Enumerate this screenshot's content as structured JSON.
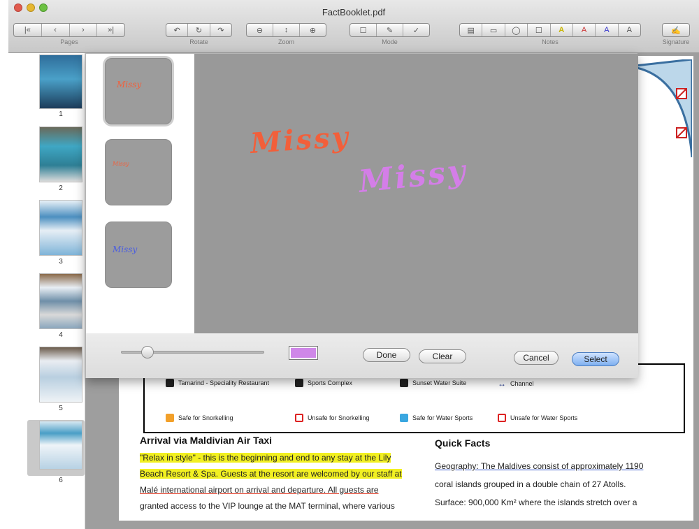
{
  "window": {
    "title": "FactBooklet.pdf"
  },
  "toolbar": {
    "groups": [
      {
        "label": "Pages",
        "buttons": [
          "|«",
          "‹",
          "›",
          "»|"
        ]
      },
      {
        "label": "Rotate",
        "buttons": [
          "↶",
          "↻",
          "↷"
        ]
      },
      {
        "label": "Zoom",
        "buttons": [
          "⊖",
          "↕",
          "⊕"
        ]
      },
      {
        "label": "Mode",
        "buttons": [
          "☐",
          "✎",
          "✓"
        ]
      },
      {
        "label": "Notes",
        "buttons": [
          "▤",
          "▭",
          "◯",
          "☐",
          "A",
          "A",
          "A",
          "A"
        ]
      },
      {
        "label": "Signature",
        "buttons": [
          "✍"
        ]
      }
    ]
  },
  "sidebar": {
    "pages": [
      {
        "num": "1"
      },
      {
        "num": "2"
      },
      {
        "num": "3"
      },
      {
        "num": "4"
      },
      {
        "num": "5"
      },
      {
        "num": "6"
      }
    ]
  },
  "signature_sheet": {
    "saved_signatures": [
      "Missy",
      "Missy",
      "Missy"
    ],
    "canvas_signatures": [
      "Missy",
      "Missy"
    ],
    "colors": {
      "orange": "#f25f3a",
      "purple": "#d47ee8",
      "blue": "#4b5ee0",
      "swatch": "#cf87e8"
    },
    "slider_value": 0.15,
    "buttons": {
      "done": "Done",
      "clear": "Clear",
      "cancel": "Cancel",
      "select": "Select"
    }
  },
  "document": {
    "legend": {
      "row1": [
        "Tamarind - Speciality Restaurant",
        "Sports Complex",
        "Sunset Water Suite",
        "Channel"
      ],
      "row2": [
        "Safe for Snorkelling",
        "Unsafe for Snorkelling",
        "Safe for Water Sports",
        "Unsafe for Water Sports"
      ]
    },
    "arrival": {
      "heading": "Arrival via Maldivian Air Taxi",
      "lines": [
        "\"Relax in style\" - this is the beginning and end to any stay at the Lily",
        "Beach Resort & Spa. Guests at the resort are welcomed by our staff at",
        "Malé international airport on arrival and departure. All guests are",
        "granted access to the VIP lounge at the MAT terminal, where various"
      ]
    },
    "facts": {
      "heading": "Quick Facts",
      "lines": [
        "Geography: The Maldives consist of approximately 1190",
        "coral islands grouped in a double chain of 27 Atolls.",
        "Surface: 900,000 Km² where the islands stretch over a"
      ]
    }
  }
}
